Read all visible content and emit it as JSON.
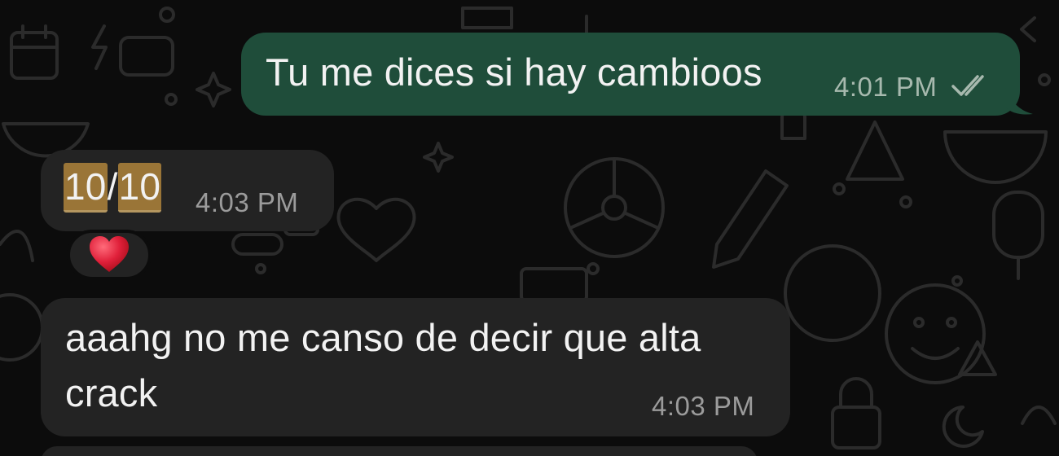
{
  "messages": [
    {
      "direction": "outgoing",
      "text": "Tu me dices si hay cambioos",
      "time": "4:01 PM",
      "status_icon": "double-check-read-icon"
    },
    {
      "direction": "incoming",
      "text_parts": [
        "10",
        "/",
        "10"
      ],
      "time": "4:03 PM",
      "reaction": {
        "emoji": "❤️",
        "icon": "red-heart-icon"
      }
    },
    {
      "direction": "incoming",
      "text_line1": "aaahg no me canso de decir que alta",
      "text_line2": "crack",
      "time": "4:03 PM"
    }
  ],
  "colors": {
    "outgoing_bubble": "#1f4d3a",
    "incoming_bubble": "#232323",
    "background": "#0c0c0c",
    "highlight": "#9a7537",
    "heart": "#e0203a"
  }
}
